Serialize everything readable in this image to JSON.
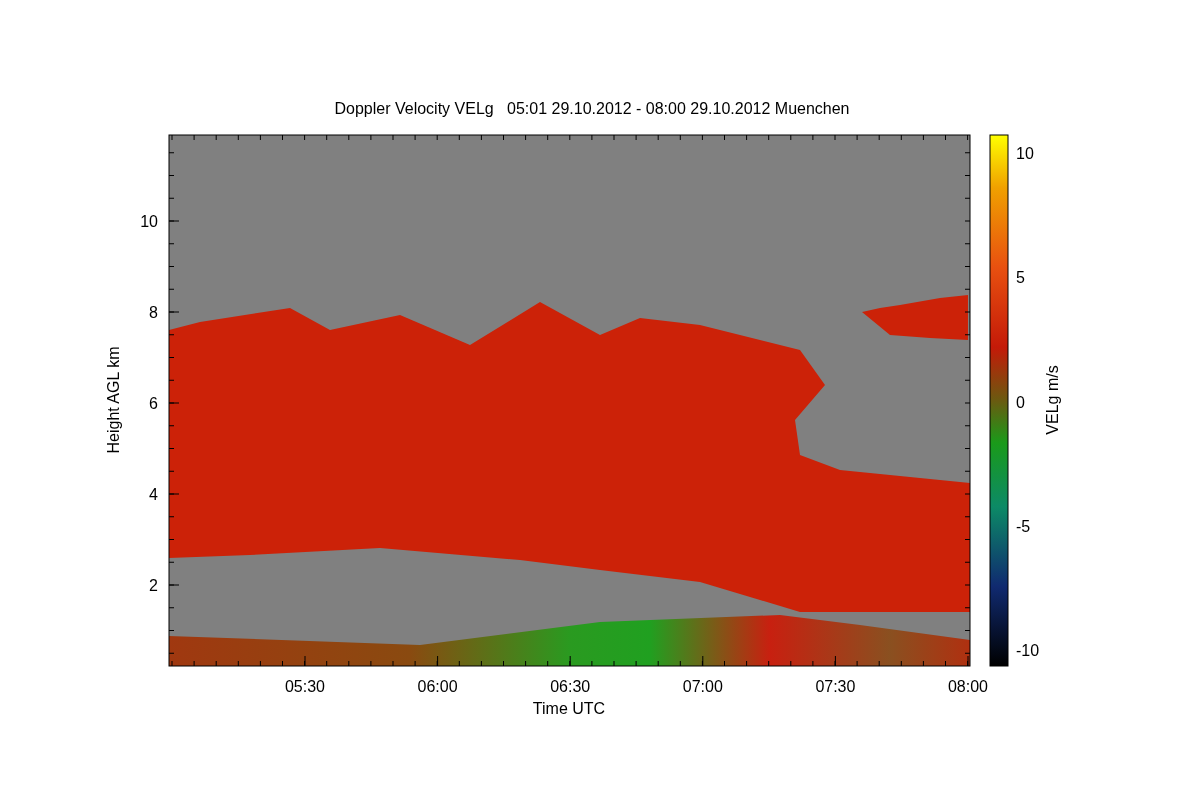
{
  "plot": {
    "title": "Doppler Velocity VELg   05:01 29.10.2012 - 08:00 29.10.2012 Muenchen",
    "x_axis": {
      "label": "Time UTC",
      "ticks": [
        "05:30",
        "06:00",
        "06:30",
        "07:00",
        "07:30",
        "08:00"
      ]
    },
    "y_axis": {
      "label": "Height AGL km",
      "ticks": [
        "10",
        "8",
        "6",
        "4",
        "2"
      ]
    }
  },
  "colorbar": {
    "label": "VELg m/s",
    "ticks": [
      "10",
      "5",
      "0",
      "-5",
      "-10"
    ]
  }
}
